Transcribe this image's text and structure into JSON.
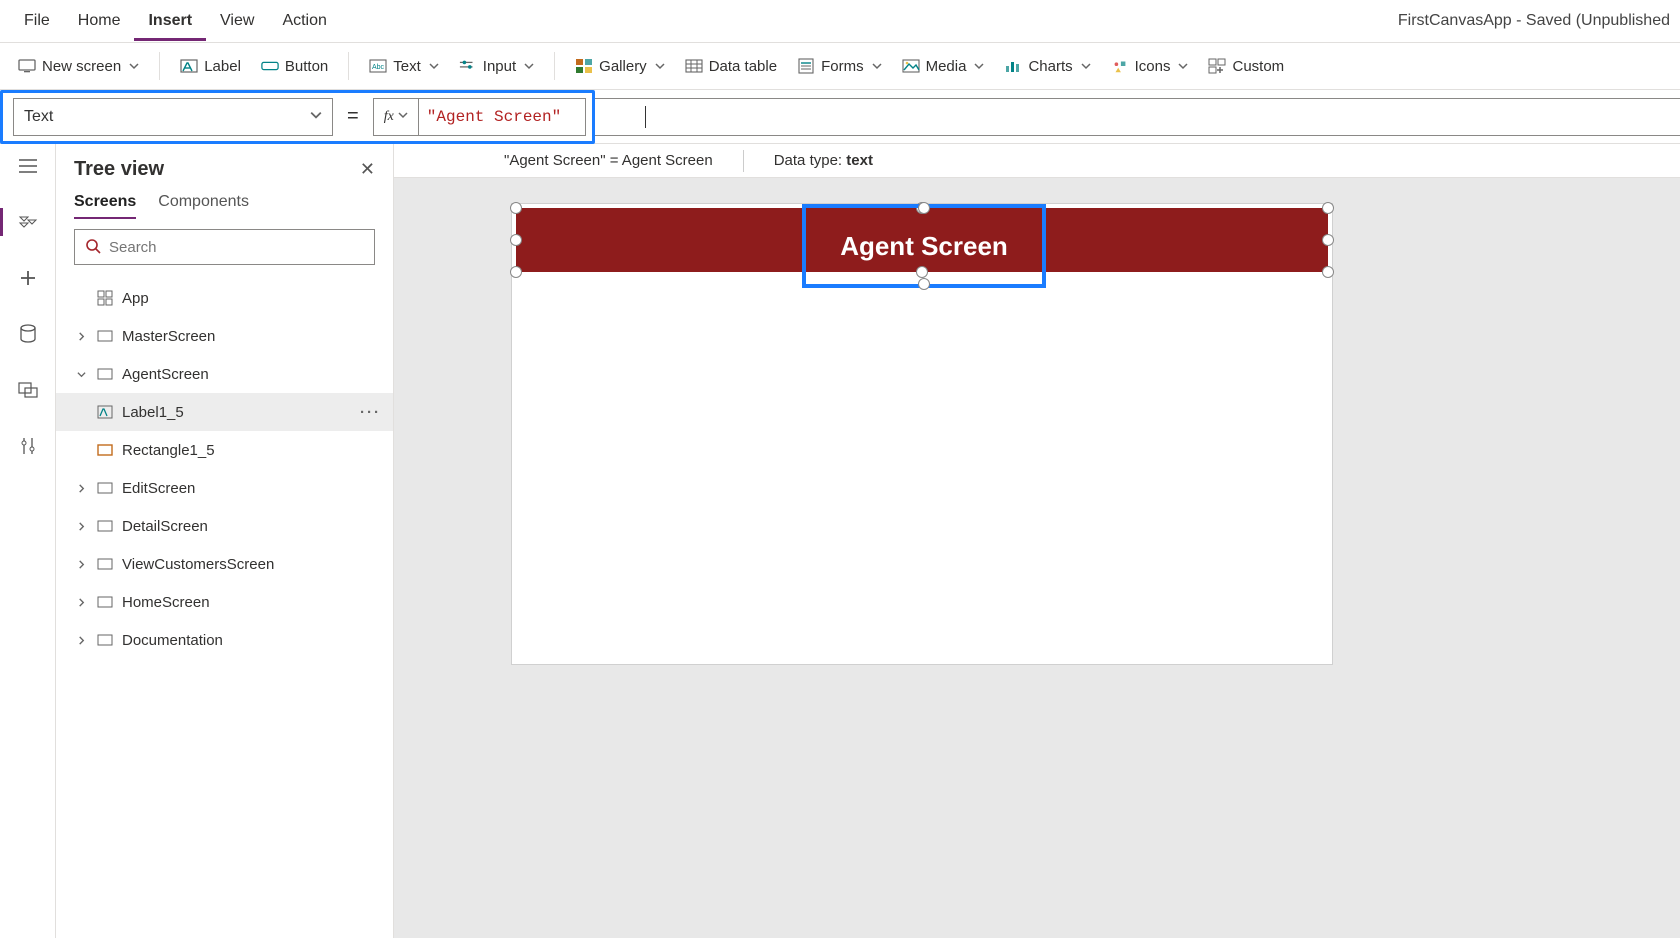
{
  "app_title": "FirstCanvasApp - Saved (Unpublished",
  "menu": {
    "file": "File",
    "home": "Home",
    "insert": "Insert",
    "view": "View",
    "action": "Action"
  },
  "ribbon": {
    "new_screen": "New screen",
    "label": "Label",
    "button": "Button",
    "text": "Text",
    "input": "Input",
    "gallery": "Gallery",
    "data_table": "Data table",
    "forms": "Forms",
    "media": "Media",
    "charts": "Charts",
    "icons": "Icons",
    "custom": "Custom"
  },
  "formula": {
    "property": "Text",
    "fx": "fx",
    "value": "\"Agent Screen\""
  },
  "status": {
    "eval": "\"Agent Screen\"  =  Agent Screen",
    "dtype_label": "Data type: ",
    "dtype_value": "text"
  },
  "treeview": {
    "title": "Tree view",
    "tabs": {
      "screens": "Screens",
      "components": "Components"
    },
    "search_placeholder": "Search",
    "app": "App",
    "items": {
      "master": "MasterScreen",
      "agent": "AgentScreen",
      "label1_5": "Label1_5",
      "rect1_5": "Rectangle1_5",
      "edit": "EditScreen",
      "detail": "DetailScreen",
      "viewcust": "ViewCustomersScreen",
      "homescr": "HomeScreen",
      "doc": "Documentation"
    }
  },
  "canvas": {
    "label_text": "Agent Screen"
  }
}
